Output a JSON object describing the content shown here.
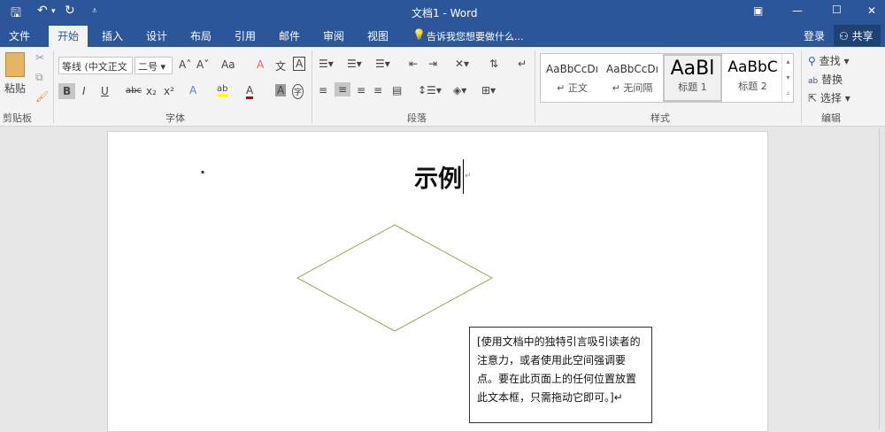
{
  "window": {
    "title": "文档1 - Word"
  },
  "quick_access": {
    "save": "🖫",
    "undo": "↶",
    "undo_arrow": "▾",
    "redo": "↻",
    "customize": "⩡"
  },
  "window_controls": {
    "ribbon_display": "▣",
    "minimize": "—",
    "maximize": "☐",
    "close": "✕"
  },
  "tabs": [
    {
      "label": "文件"
    },
    {
      "label": "开始"
    },
    {
      "label": "插入"
    },
    {
      "label": "设计"
    },
    {
      "label": "布局"
    },
    {
      "label": "引用"
    },
    {
      "label": "邮件"
    },
    {
      "label": "审阅"
    },
    {
      "label": "视图"
    }
  ],
  "tell_me": "告诉我您想要做什么...",
  "signin": "登录",
  "share": "共享",
  "clipboard": {
    "paste": "粘贴",
    "label": "剪贴板"
  },
  "font": {
    "name": "等线 (中文正文",
    "size": "二号",
    "label": "字体",
    "bold": "B",
    "italic": "I",
    "underline": "U",
    "strike": "abc",
    "sub": "x₂",
    "sup": "x²",
    "grow": "A˄",
    "shrink": "A˅",
    "case": "Aa",
    "clear": "A",
    "pinyin": "文",
    "border": "A",
    "effects": "A",
    "highlight": "ab",
    "color": "A",
    "shade": "A",
    "enclose": "字"
  },
  "paragraph": {
    "label": "段落"
  },
  "styles": {
    "label": "样式",
    "items": [
      {
        "preview": "AaBbCcDı",
        "name": "↵ 正文"
      },
      {
        "preview": "AaBbCcDı",
        "name": "↵ 无间隔"
      },
      {
        "preview": "AaBl",
        "name": "标题 1"
      },
      {
        "preview": "AaBbC",
        "name": "标题 2"
      }
    ]
  },
  "editing": {
    "label": "编辑",
    "find": "查找",
    "replace": "替换",
    "select": "选择"
  },
  "document": {
    "heading": "示例",
    "bullet": "·",
    "textbox": "[使用文档中的独特引言吸引读者的注意力，或者使用此空间强调要点。要在此页面上的任何位置放置此文本框，只需拖动它即可。]↵",
    "para_mark": "↵"
  },
  "colors": {
    "accent": "#2b579a",
    "diamond": "#8fae5a"
  }
}
